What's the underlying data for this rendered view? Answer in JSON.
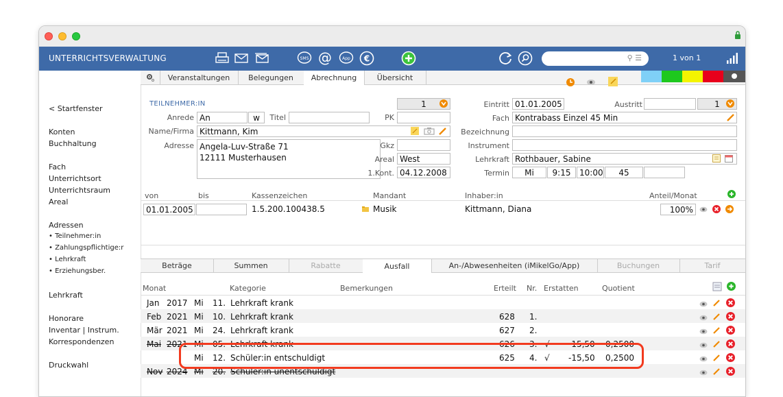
{
  "app": {
    "title": "UNTERRICHTSVERWALTUNG",
    "record_count": "1 von 1"
  },
  "sidebar": {
    "back": "< Startfenster",
    "items": [
      "Konten",
      "Buchhaltung",
      "Fach",
      "Unterrichtsort",
      "Unterrichtsraum",
      "Areal",
      "Adressen",
      "• Teilnehmer:in",
      "• Zahlungspflichtige:r",
      "• Lehrkraft",
      "• Erziehungsber.",
      "Lehrkraft",
      "Honorare",
      "Inventar | Instrum.",
      "Korrespondenzen",
      "Druckwahl"
    ]
  },
  "tabs": [
    "Veranstaltungen",
    "Belegungen",
    "Abrechnung",
    "Übersicht"
  ],
  "active_tab": "Abrechnung",
  "colors": {
    "toolbar": "#3e6aa8",
    "swatches": [
      "#7fd0f7",
      "#1ec81e",
      "#f4f400",
      "#e8001c",
      "#555555"
    ],
    "highlight": "#f23a1e"
  },
  "participant": {
    "section": "TEILNEHMER:IN",
    "counter": "1",
    "anrede_label": "Anrede",
    "anrede": "An",
    "gender": "w",
    "titel_label": "Titel",
    "titel": "",
    "pk_label": "PK",
    "pk": "",
    "name_label": "Name/Firma",
    "name": "Kittmann, Kim",
    "adresse_label": "Adresse",
    "adresse_line1": "Angela-Luv-Straße 71",
    "adresse_line2": "12111 Musterhausen",
    "gkz_label": "Gkz",
    "gkz": "",
    "areal_label": "Areal",
    "areal": "West",
    "kont_label": "1.Kont.",
    "kont": "04.12.2008"
  },
  "course": {
    "eintritt_label": "Eintritt",
    "eintritt": "01.01.2005",
    "austritt_label": "Austritt",
    "austritt": "",
    "counter": "1",
    "fach_label": "Fach",
    "fach": "Kontrabass Einzel 45 Min",
    "bezeichnung_label": "Bezeichnung",
    "bezeichnung": "",
    "instrument_label": "Instrument",
    "instrument": "",
    "lehrkraft_label": "Lehrkraft",
    "lehrkraft": "Rothbauer, Sabine",
    "termin_label": "Termin",
    "termin_day": "Mi",
    "termin_start": "9:15",
    "termin_end": "10:00",
    "termin_duration": "45"
  },
  "billing": {
    "headers": {
      "von": "von",
      "bis": "bis",
      "kassenzeichen": "Kassenzeichen",
      "mandant": "Mandant",
      "inhaber": "Inhaber:in",
      "anteil": "Anteil/Monat"
    },
    "row": {
      "von": "01.01.2005",
      "bis": "",
      "kassenzeichen": "1.5.200.100438.5",
      "mandant": "Musik",
      "inhaber": "Kittmann, Diana",
      "anteil": "100%"
    }
  },
  "subtabs": [
    "Beträge",
    "Summen",
    "Rabatte",
    "Ausfall",
    "An-/Abwesenheiten (iMikelGo/App)",
    "Buchungen",
    "Tarif"
  ],
  "active_subtab": "Ausfall",
  "ausfall": {
    "headers": {
      "monat": "Monat",
      "kategorie": "Kategorie",
      "bemerkungen": "Bemerkungen",
      "erteilt": "Erteilt",
      "nr": "Nr.",
      "erstatten": "Erstatten",
      "quotient": "Quotient"
    },
    "rows": [
      {
        "month": "Jan",
        "year": "2017",
        "day": "Mi",
        "date": "11.",
        "kategorie": "Lehrkraft krank",
        "erteilt": "",
        "nr": "",
        "erstatten_mark": "",
        "erstatten": "",
        "quotient": ""
      },
      {
        "month": "Feb",
        "year": "2021",
        "day": "Mi",
        "date": "10.",
        "kategorie": "Lehrkraft krank",
        "erteilt": "628",
        "nr": "1.",
        "erstatten_mark": "",
        "erstatten": "",
        "quotient": ""
      },
      {
        "month": "Mär",
        "year": "2021",
        "day": "Mi",
        "date": "24.",
        "kategorie": "Lehrkraft krank",
        "erteilt": "627",
        "nr": "2.",
        "erstatten_mark": "",
        "erstatten": "",
        "quotient": ""
      },
      {
        "month": "Mai",
        "year": "2021",
        "day": "Mi",
        "date": "05.",
        "kategorie": "Lehrkraft krank",
        "erteilt": "626",
        "nr": "3.",
        "erstatten_mark": "√",
        "erstatten": "-15,50",
        "quotient": "0,2500"
      },
      {
        "month": "",
        "year": "",
        "day": "Mi",
        "date": "12.",
        "kategorie": "Schüler:in entschuldigt",
        "erteilt": "625",
        "nr": "4.",
        "erstatten_mark": "√",
        "erstatten": "-15,50",
        "quotient": "0,2500"
      },
      {
        "month": "Nov",
        "year": "2024",
        "day": "Mi",
        "date": "20.",
        "kategorie": "Schüler:in unentschuldigt",
        "erteilt": "",
        "nr": "",
        "erstatten_mark": "",
        "erstatten": "",
        "quotient": ""
      }
    ]
  }
}
